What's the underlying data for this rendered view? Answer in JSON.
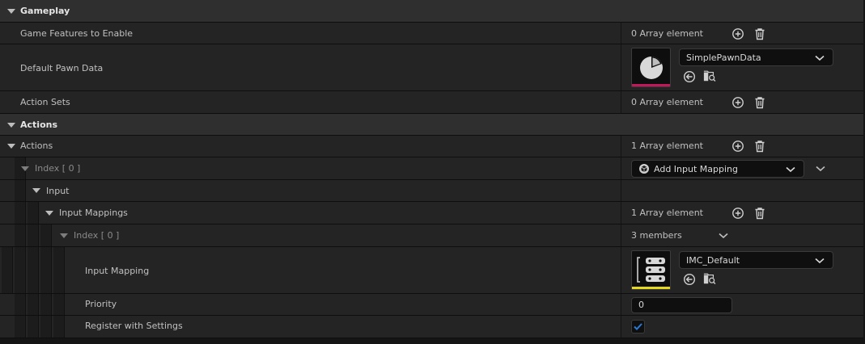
{
  "sections": {
    "gameplay": "Gameplay",
    "actions": "Actions"
  },
  "gameplay": {
    "game_features_label": "Game Features to Enable",
    "game_features_count": "0 Array element",
    "default_pawn_label": "Default Pawn Data",
    "default_pawn_value": "SimplePawnData",
    "action_sets_label": "Action Sets",
    "action_sets_count": "0 Array element"
  },
  "actions": {
    "actions_label": "Actions",
    "actions_count": "1 Array element",
    "index0_label": "Index [ 0 ]",
    "index0_value": "Add Input Mapping",
    "input_label": "Input",
    "input_mappings_label": "Input Mappings",
    "input_mappings_count": "1 Array element",
    "mapping_index_label": "Index [ 0 ]",
    "mapping_index_value": "3 members",
    "input_mapping_label": "Input Mapping",
    "input_mapping_value": "IMC_Default",
    "priority_label": "Priority",
    "priority_value": "0",
    "register_label": "Register with Settings",
    "register_checked": true
  },
  "icons": [
    "expand-arrow-icon",
    "add-element-icon",
    "delete-icon",
    "combo-chevron-icon",
    "browse-arrow-icon",
    "find-in-browser-icon",
    "action-struct-icon",
    "pawn-data-asset-icon",
    "input-mapping-asset-icon",
    "checkmark-icon"
  ],
  "colors": {
    "pawn_asset_underline": "#c2185b",
    "mapping_asset_underline": "#e6d81a",
    "checkbox_check": "#2a7ad5"
  }
}
